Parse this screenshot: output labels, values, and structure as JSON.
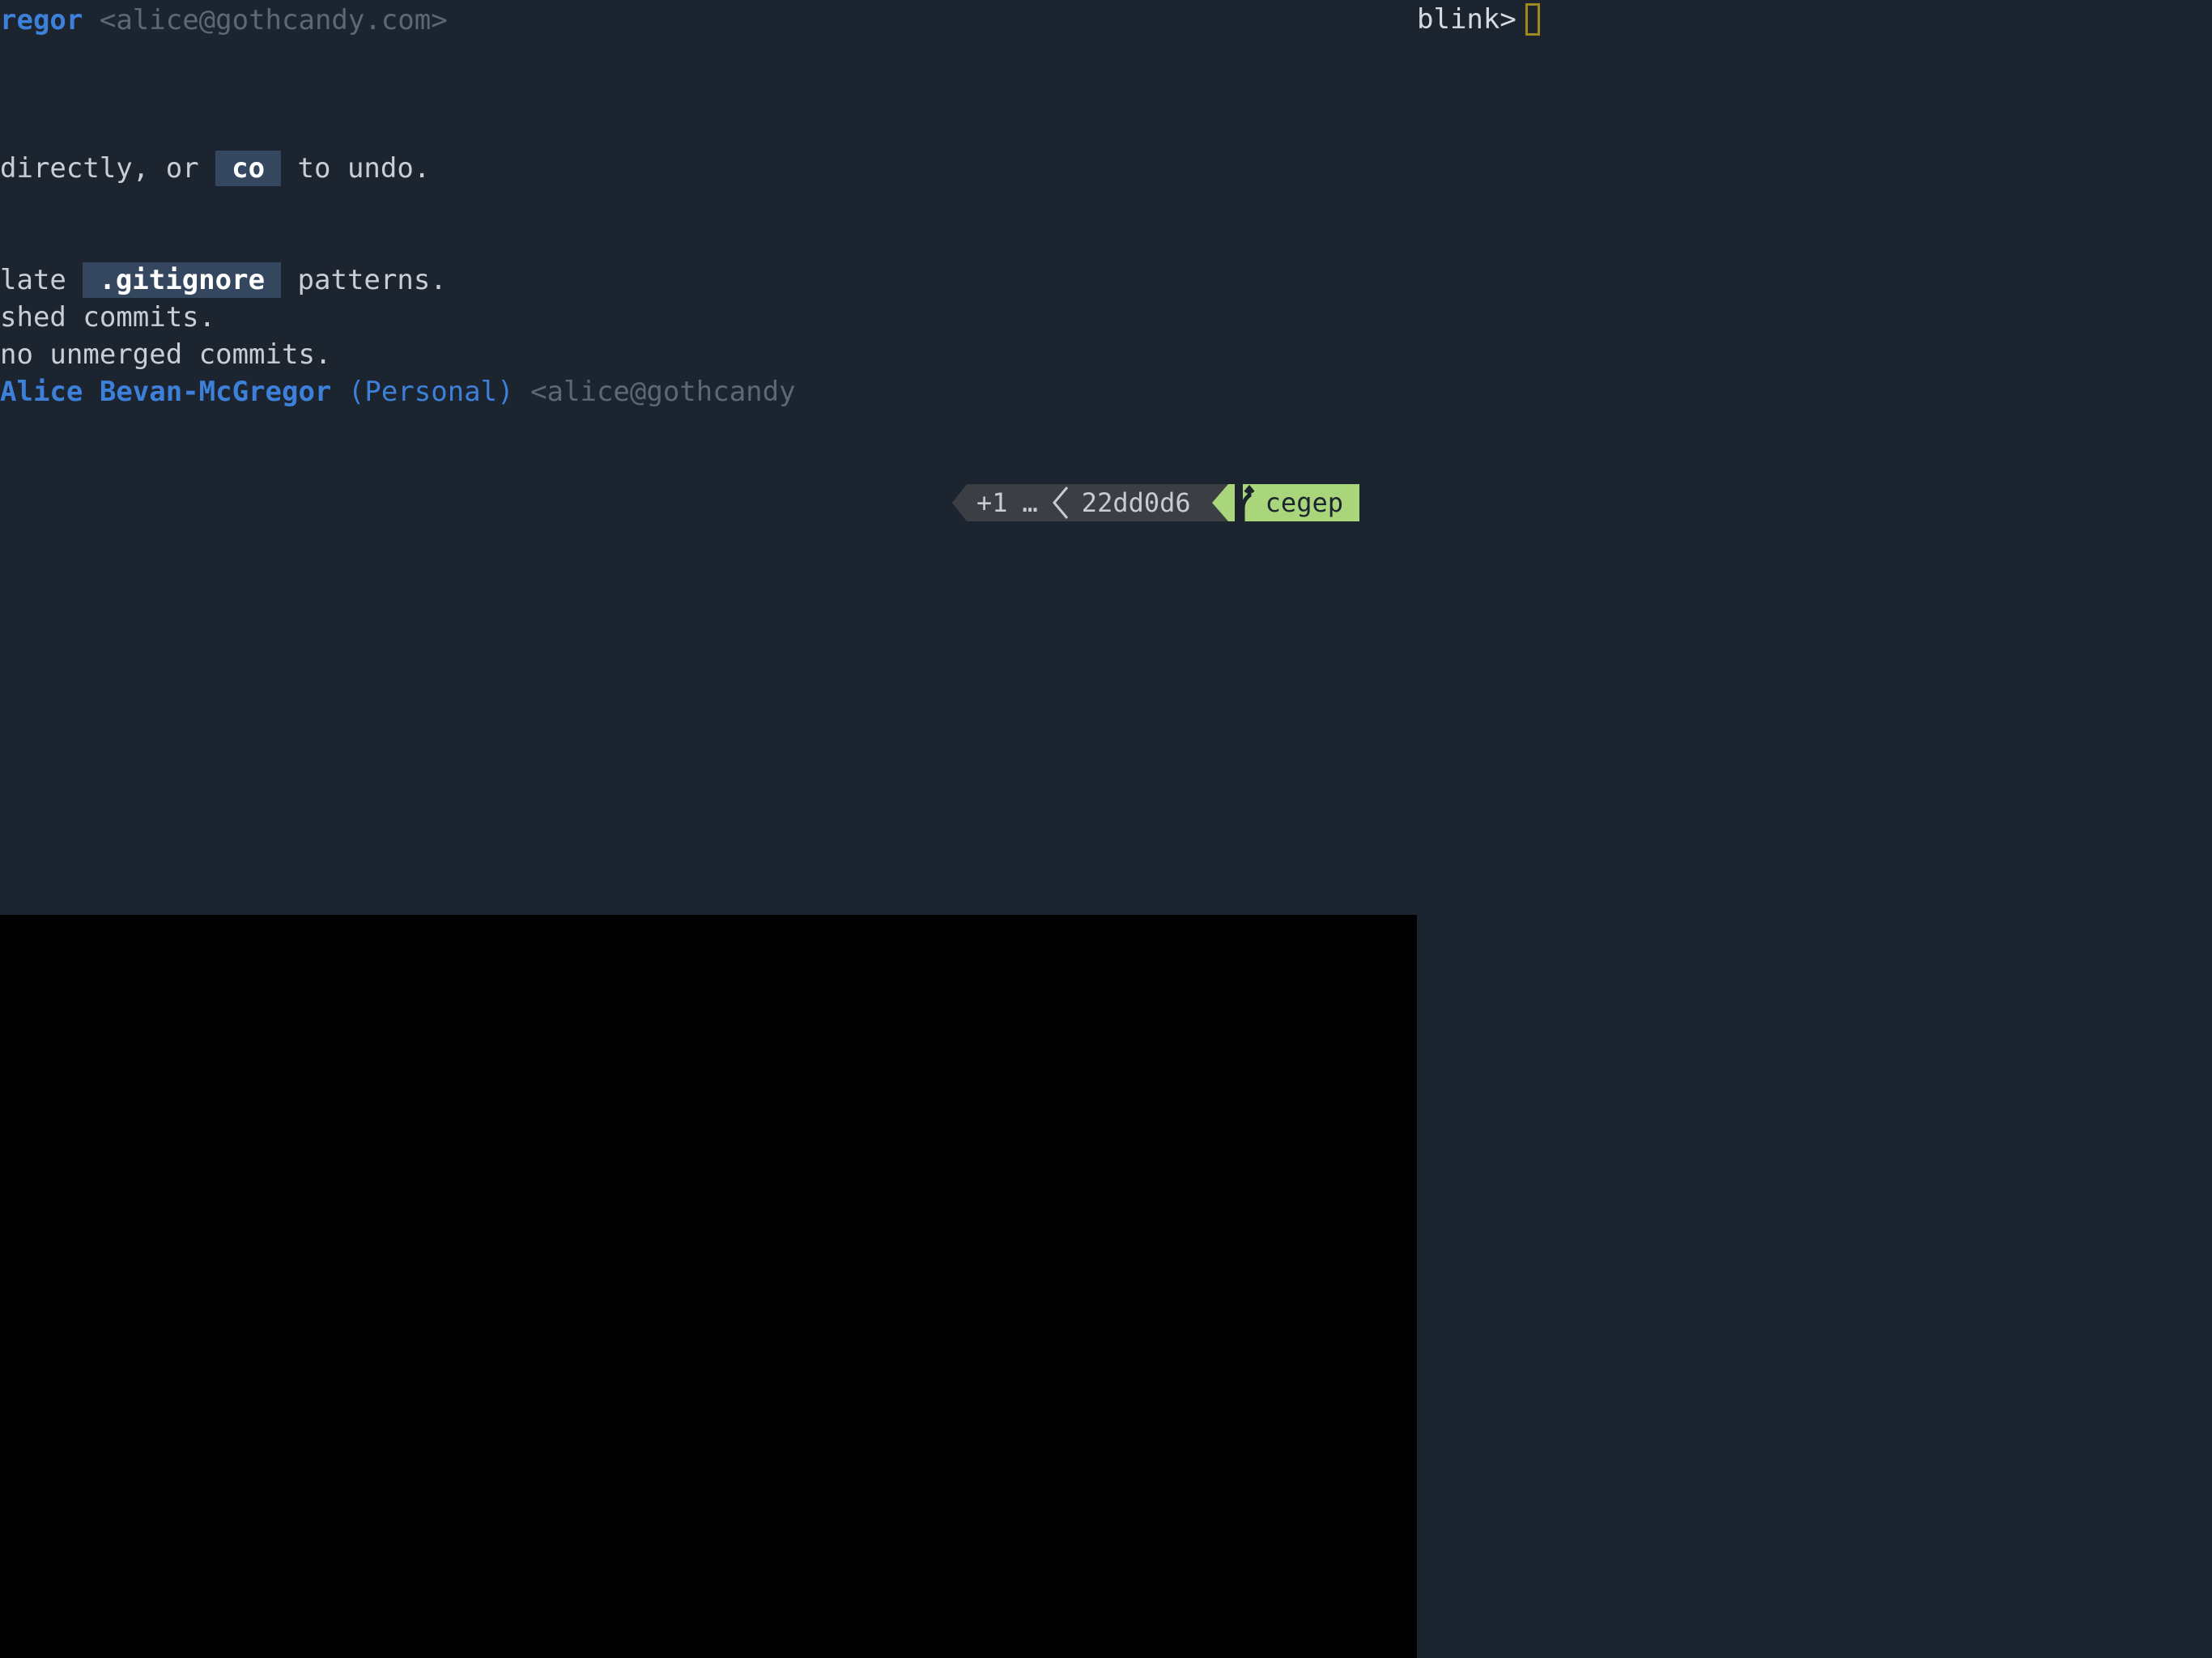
{
  "terminal": {
    "author_line": {
      "name": "regor",
      "email": "<alice@gothcandy.com>"
    },
    "undo_line": {
      "prefix": "directly, or ",
      "command": "co",
      "suffix": " to undo."
    },
    "gitignore_line": {
      "prefix": "late ",
      "file": ".gitignore",
      "suffix": " patterns."
    },
    "pushed_line": "shed commits.",
    "unmerged_line": "no unmerged commits.",
    "identity_line": {
      "name": "Alice Bevan-McGregor",
      "context": "(Personal)",
      "email": "<alice@gothcandy"
    }
  },
  "prompt": {
    "label": "blink>"
  },
  "status": {
    "ahead": "+1",
    "ellipsis": "…",
    "commit": "22dd0d6",
    "branch_icon": "git-branch-icon",
    "branch": "cegep"
  },
  "colors": {
    "background": "#1c2430",
    "accent_blue": "#3d80d9",
    "chip_bg": "#34475f",
    "status_gray": "#3b3f44",
    "status_green": "#a9d67a",
    "cursor": "#9c8a1e",
    "pane_black": "#000000"
  }
}
